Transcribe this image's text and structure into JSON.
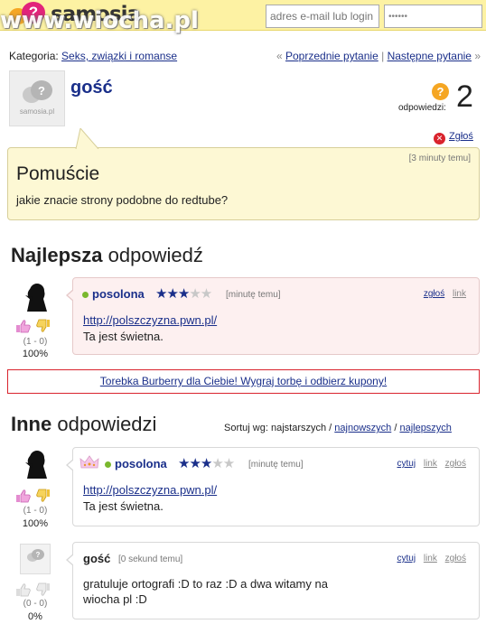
{
  "header": {
    "logo_glyph": "?",
    "logo_text": "samosia",
    "watermark": "www.wiocha.pl",
    "email_placeholder": "adres e-mail lub login",
    "password_value": "••••••"
  },
  "category": {
    "label": "Kategoria:",
    "name": "Seks, związki i romanse",
    "prev": "Poprzednie pytanie",
    "next": "Następne pytanie",
    "left_quote": "«",
    "sep": "|",
    "right_quote": "»"
  },
  "question": {
    "author": "gość",
    "answers_label": "odpowiedzi:",
    "answers_count": "2",
    "answers_icon_glyph": "?",
    "report_label": "Zgłoś",
    "time": "[3 minuty temu]",
    "title": "Pomuście",
    "body": "jakie znacie strony podobne do redtube?"
  },
  "best_answer": {
    "heading_bold": "Najlepsza",
    "heading_rest": "odpowiedź",
    "user": "posolona",
    "rating": 3,
    "rating_max": 5,
    "time": "[minutę temu]",
    "actions": [
      "zgłoś",
      "link"
    ],
    "link": "http://polszczyzna.pwn.pl/",
    "text": "Ta jest świetna.",
    "score": "(1 - 0)",
    "percent": "100%"
  },
  "ad": {
    "text": "Torebka Burberry dla Ciebie! Wygraj torbę i odbierz kupony!"
  },
  "other_answers": {
    "heading_bold": "Inne",
    "heading_rest": "odpowiedzi",
    "sort_label": "Sortuj wg: najstarszych /",
    "sort_newest": "najnowszych",
    "sort_sep": "/",
    "sort_best": "najlepszych",
    "items": [
      {
        "user": "posolona",
        "rating": 3,
        "rating_max": 5,
        "time": "[minutę temu]",
        "actions": [
          "cytuj",
          "link",
          "zgłoś"
        ],
        "link": "http://polszczyzna.pwn.pl/",
        "text": "Ta jest świetna.",
        "score": "(1 - 0)",
        "percent": "100%"
      },
      {
        "user": "gość",
        "time": "[0 sekund temu]",
        "actions": [
          "cytuj",
          "link",
          "zgłoś"
        ],
        "text_line1": "gratuluje ortografi :D to raz :D a dwa witamy na",
        "text_line2": "wiocha pl :D",
        "score": "(0 - 0)",
        "percent": "0%"
      }
    ]
  },
  "avatar_caption": "samosia.pl",
  "colors": {
    "header_bg": "#fdf2a3",
    "link": "#1a2f8a",
    "question_bg": "#fdf8d4",
    "best_answer_bg": "#fdf0f0",
    "ad_border": "#d9232d",
    "online_dot": "#7ab82e"
  },
  "icons": [
    "question-mark-icon",
    "report-x-icon",
    "thumb-up-icon",
    "thumb-down-icon",
    "star-icon",
    "crown-icon",
    "user-silhouette-icon",
    "default-avatar-icon"
  ]
}
